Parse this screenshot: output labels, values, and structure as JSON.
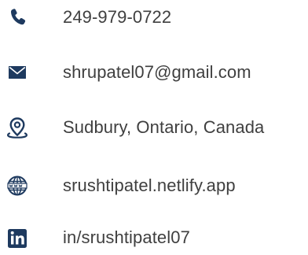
{
  "contact": {
    "accent_color": "#1e3a5f",
    "items": [
      {
        "icon": "phone-icon",
        "label": "249-979-0722"
      },
      {
        "icon": "mail-icon",
        "label": "shrupatel07@gmail.com"
      },
      {
        "icon": "location-pin-icon",
        "label": "Sudbury, Ontario, Canada"
      },
      {
        "icon": "globe-www-icon",
        "label": "srushtipatel.netlify.app"
      },
      {
        "icon": "linkedin-icon",
        "label": "in/srushtipatel07"
      }
    ]
  }
}
